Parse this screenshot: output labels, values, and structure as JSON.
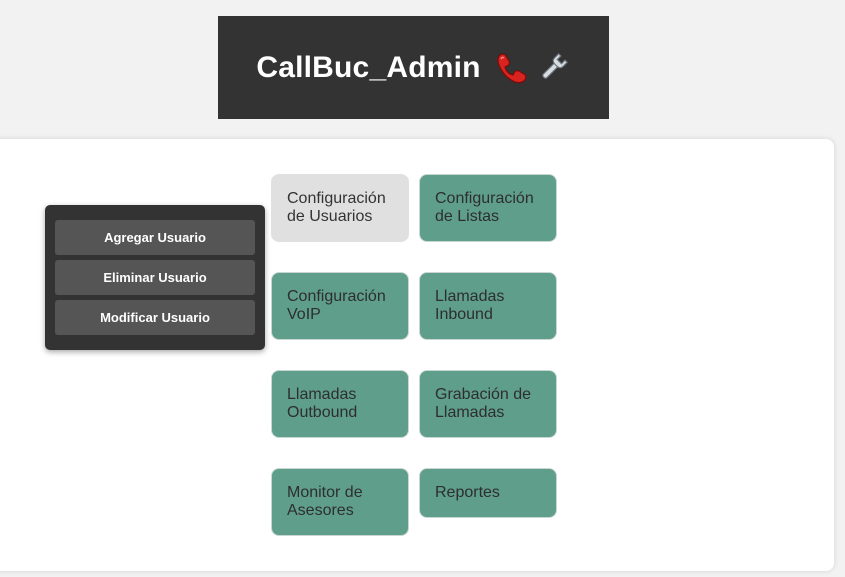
{
  "header": {
    "title": "CallBuc_Admin",
    "icons": [
      "telephone-receiver-icon",
      "wrench-icon"
    ]
  },
  "submenu": {
    "items": [
      {
        "label": "Agregar Usuario"
      },
      {
        "label": "Eliminar Usuario"
      },
      {
        "label": "Modificar Usuario"
      }
    ]
  },
  "tiles": [
    {
      "label": "Configuración\nde Usuarios",
      "active": true
    },
    {
      "label": "Configuración\nde Listas"
    },
    {
      "label": "Configuración\nVoIP"
    },
    {
      "label": "Llamadas\nInbound"
    },
    {
      "label": "Llamadas\nOutbound"
    },
    {
      "label": "Grabación de\nLlamadas"
    },
    {
      "label": "Monitor de\nAsesores"
    },
    {
      "label": "Reportes"
    }
  ],
  "colors": {
    "header_bg": "#333333",
    "tile_bg": "#5e9e8a",
    "tile_active_bg": "#e0e0e0",
    "submenu_bg": "#333333",
    "submenu_item_bg": "#555555",
    "page_bg": "#f2f2f2"
  }
}
